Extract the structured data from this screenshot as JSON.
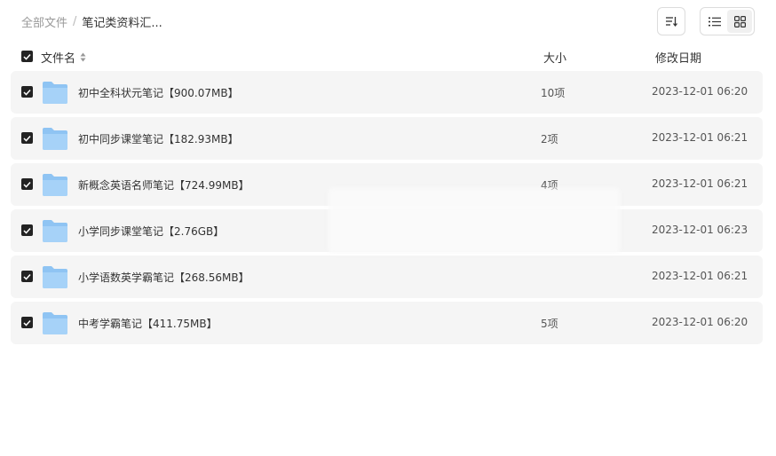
{
  "breadcrumb": {
    "root": "全部文件",
    "separator": "/",
    "current": "笔记类资料汇..."
  },
  "toolbar": {
    "sort_icon": "sort-lines-icon",
    "list_view_icon": "list-view-icon",
    "grid_view_icon": "grid-view-icon"
  },
  "table": {
    "headers": {
      "name": "文件名",
      "size": "大小",
      "date": "修改日期"
    },
    "rows": [
      {
        "name": "初中全科状元笔记【900.07MB】",
        "size": "10项",
        "date": "2023-12-01 06:20"
      },
      {
        "name": "初中同步课堂笔记【182.93MB】",
        "size": "2项",
        "date": "2023-12-01 06:21"
      },
      {
        "name": "新概念英语名师笔记【724.99MB】",
        "size": "4项",
        "date": "2023-12-01 06:21"
      },
      {
        "name": "小学同步课堂笔记【2.76GB】",
        "size": "",
        "date": "2023-12-01 06:23"
      },
      {
        "name": "小学语数英学霸笔记【268.56MB】",
        "size": "",
        "date": "2023-12-01 06:21"
      },
      {
        "name": "中考学霸笔记【411.75MB】",
        "size": "5项",
        "date": "2023-12-01 06:20"
      }
    ]
  },
  "colors": {
    "folder": "#8fc4f3",
    "checkbox": "#232323",
    "row_bg": "#f5f5f5"
  }
}
